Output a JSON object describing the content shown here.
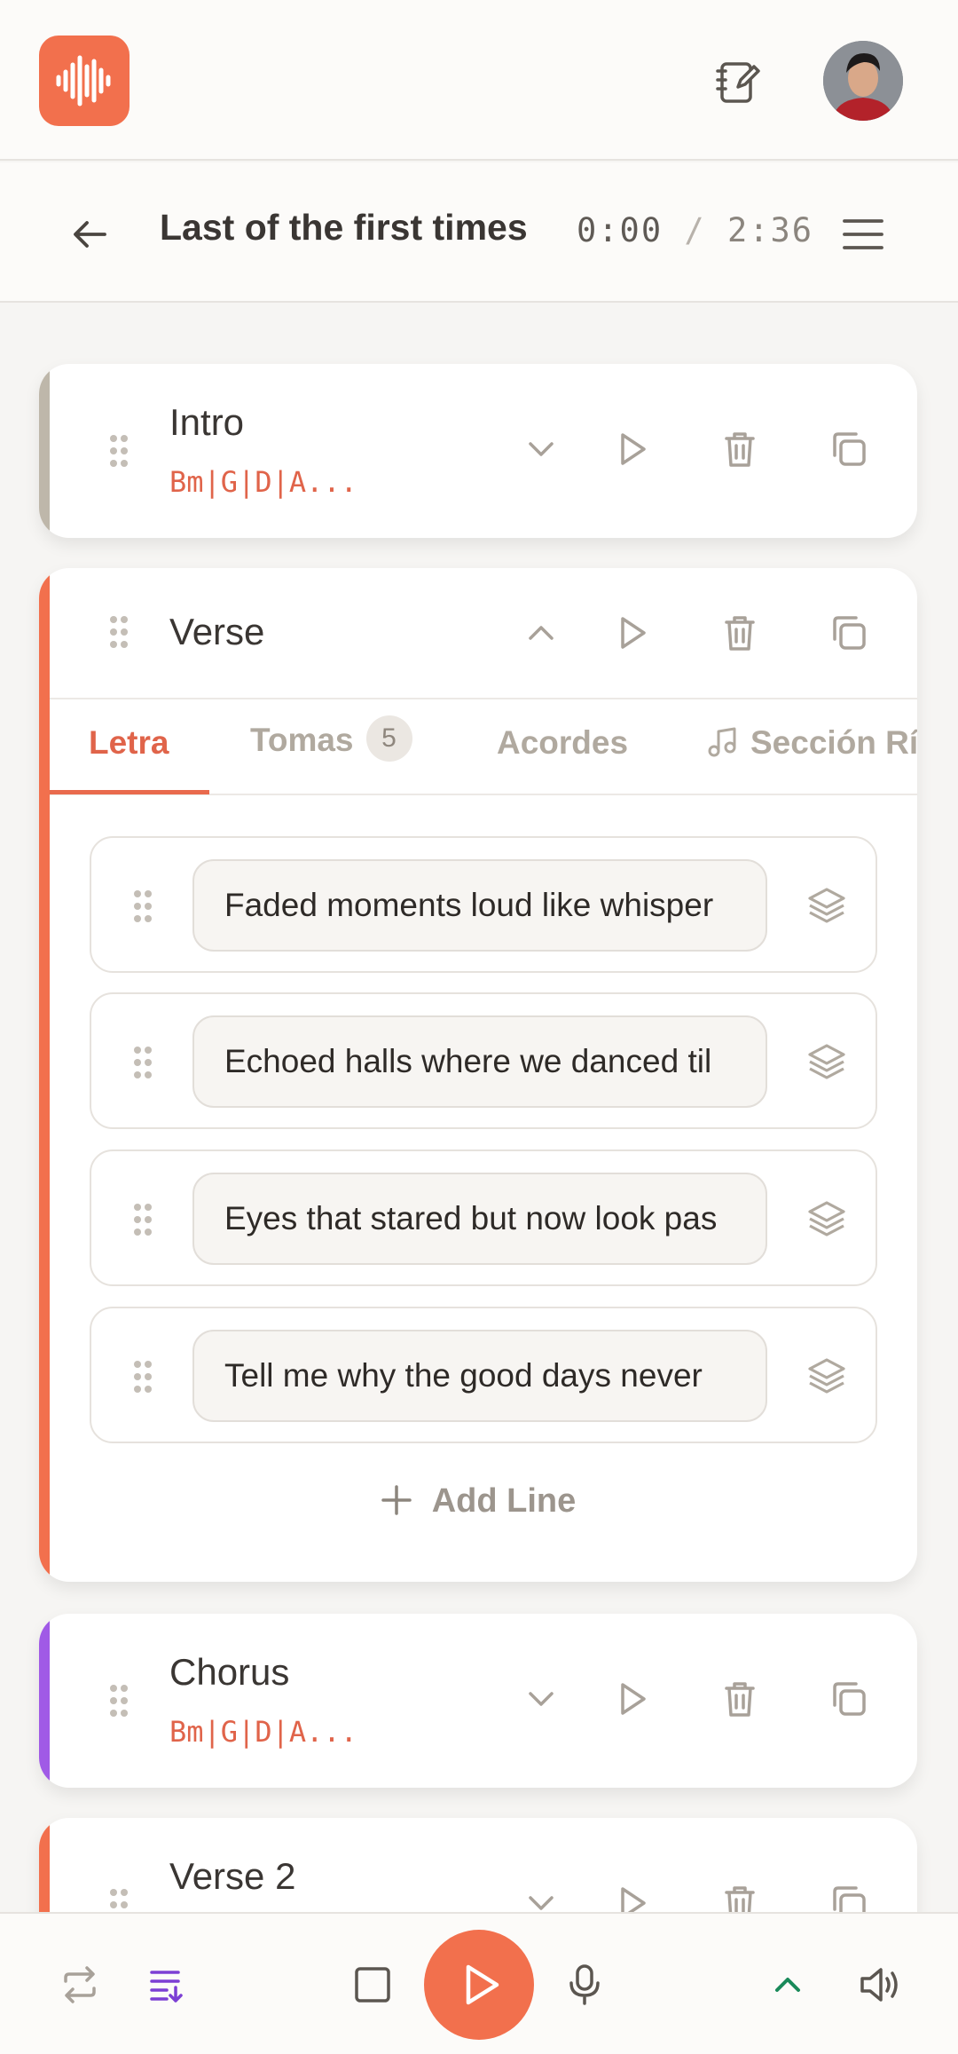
{
  "colors": {
    "brand": "#f2704d",
    "intro_accent": "#beb7aa",
    "verse_accent": "#f2704d",
    "chorus_accent": "#a05ae6",
    "verse2_accent": "#f2704d",
    "chord_text": "#e0644a",
    "queue_icon": "#7c3fd4",
    "expand_up_icon": "#1a8a5a"
  },
  "header": {
    "logo_icon": "waveform-icon",
    "notes_icon": "notebook-edit-icon",
    "avatar_icon": "user-avatar"
  },
  "song": {
    "title": "Last of the first times",
    "time_current": "0:00",
    "time_sep": "/",
    "time_total": "2:36"
  },
  "sections": [
    {
      "title": "Intro",
      "chords": "Bm|G|D|A...",
      "expanded": false
    },
    {
      "title": "Verse",
      "chords": "",
      "expanded": true
    },
    {
      "title": "Chorus",
      "chords": "Bm|G|D|A...",
      "expanded": false
    },
    {
      "title": "Verse 2",
      "chords": "",
      "expanded": false
    }
  ],
  "tabs": {
    "letra": "Letra",
    "tomas": "Tomas",
    "tomas_count": "5",
    "acordes": "Acordes",
    "seccion": "Sección Rí"
  },
  "lyrics": [
    "Faded moments loud like whisper",
    "Echoed halls where we danced til",
    "Eyes that stared but now look pas",
    "Tell me why the good days never"
  ],
  "add_line_label": "Add Line",
  "player": {
    "repeat_icon": "repeat-icon",
    "queue_icon": "queue-icon",
    "stop_icon": "stop-icon",
    "play_icon": "play-icon",
    "mic_icon": "microphone-icon",
    "expand_icon": "chevron-up-icon",
    "volume_icon": "volume-icon"
  }
}
